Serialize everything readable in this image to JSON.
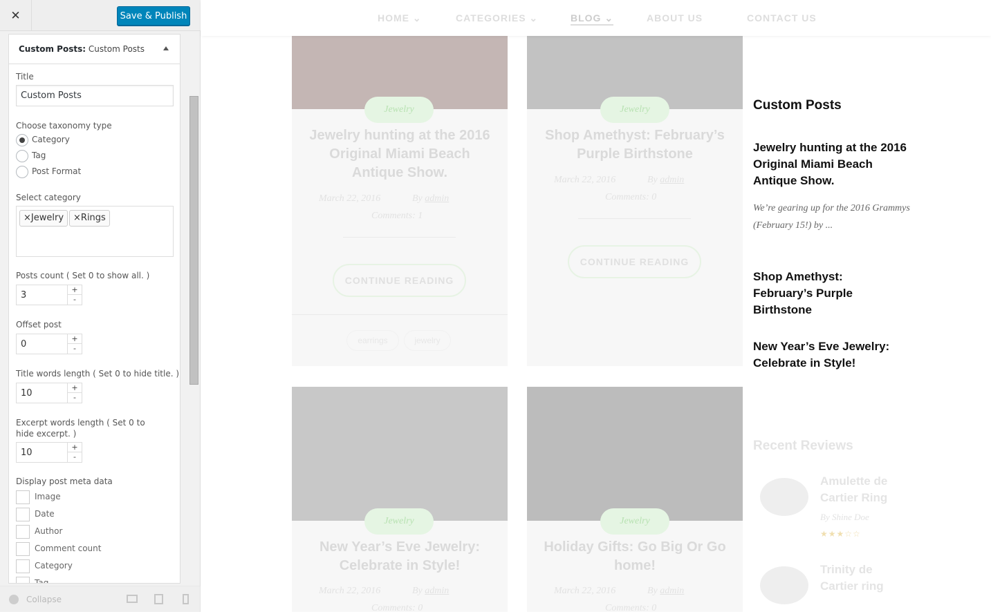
{
  "customizer": {
    "close_glyph": "✕",
    "save_label": "Save & Publish",
    "section_prefix": "Custom Posts:",
    "section_name": "Custom Posts",
    "title_label": "Title",
    "title_value": "Custom Posts",
    "taxonomy_label": "Choose taxonomy type",
    "taxonomy_options": [
      "Category",
      "Tag",
      "Post Format"
    ],
    "taxonomy_selected": "Category",
    "category_label": "Select category",
    "categories": [
      "Jewelry",
      "Rings"
    ],
    "chip_remove": "×",
    "posts_count_label": "Posts count ( Set 0 to show all. )",
    "posts_count": "3",
    "offset_label": "Offset post",
    "offset": "0",
    "title_words_label": "Title words length ( Set 0 to hide title. )",
    "title_words": "10",
    "excerpt_words_label": "Excerpt words length ( Set 0 to hide excerpt. )",
    "excerpt_words": "10",
    "meta_label": "Display post meta data",
    "meta_options": [
      "Image",
      "Date",
      "Author",
      "Comment count",
      "Category",
      "Tag"
    ],
    "spin_up": "+",
    "spin_down": "-",
    "collapse_label": "Collapse"
  },
  "preview": {
    "nav": [
      "HOME",
      "CATEGORIES",
      "BLOG",
      "ABOUT US",
      "CONTACT US"
    ],
    "posts": [
      {
        "category": "Jewelry",
        "title": "Jewelry hunting at the 2016 Original Miami Beach Antique Show.",
        "date": "March 22, 2016",
        "by": "By",
        "author": "admin",
        "comments": "Comments: 1",
        "button": "CONTINUE READING",
        "tags": [
          "earrings",
          "jewelry"
        ]
      },
      {
        "category": "Jewelry",
        "title": "Shop Amethyst: February’s Purple Birthstone",
        "date": "March 22, 2016",
        "by": "By",
        "author": "admin",
        "comments": "Comments: 0",
        "button": "CONTINUE READING"
      },
      {
        "category": "Jewelry",
        "title": "New Year’s Eve Jewelry: Celebrate in Style!",
        "date": "March 22, 2016",
        "by": "By",
        "author": "admin",
        "comments": "Comments: 0"
      },
      {
        "category": "Jewelry",
        "title": "Holiday Gifts: Go Big Or Go home!",
        "date": "March 22, 2016",
        "by": "By",
        "author": "admin",
        "comments": "Comments: 0"
      }
    ],
    "sidebar": {
      "widget_title": "Custom Posts",
      "items": [
        {
          "title": "Jewelry hunting at the 2016 Original Miami Beach Antique Show.",
          "excerpt": "We’re gearing up for the 2016 Grammys (February 15!) by ..."
        },
        {
          "title": "Shop Amethyst: February’s Purple Birthstone"
        },
        {
          "title": "New Year’s Eve Jewelry: Celebrate in Style!"
        }
      ],
      "reviews_title": "Recent Reviews",
      "reviews": [
        {
          "name": "Amulette de Cartier Ring",
          "by": "By Shine Doe"
        },
        {
          "name": "Trinity de Cartier ring"
        }
      ]
    }
  }
}
